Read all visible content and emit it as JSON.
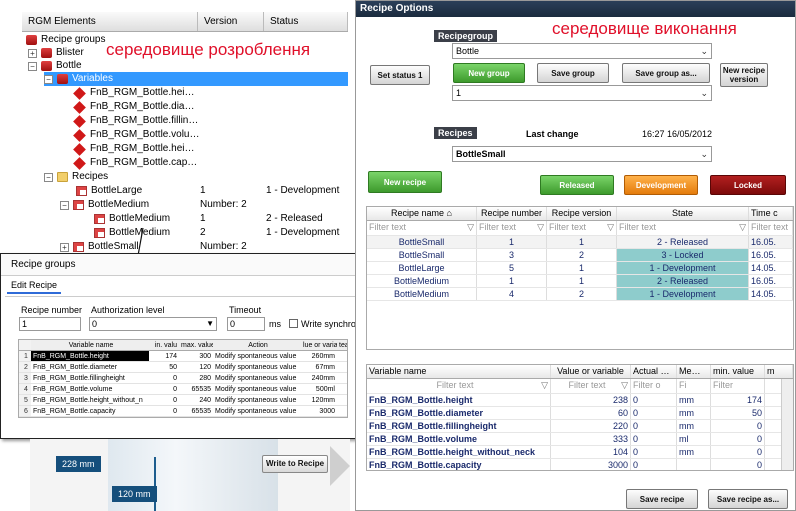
{
  "dev_tree": {
    "columns": [
      "RGM Elements",
      "Version",
      "Status"
    ],
    "overlay_text": "середовище розроблення",
    "nodes": [
      {
        "label": "Recipe groups",
        "version": "",
        "status": ""
      },
      {
        "label": "Blister",
        "version": "",
        "status": ""
      },
      {
        "label": "Bottle",
        "version": "",
        "status": ""
      },
      {
        "label": "Variables",
        "version": "",
        "status": ""
      },
      {
        "label": "FnB_RGM_Bottle.hei…",
        "version": "",
        "status": ""
      },
      {
        "label": "FnB_RGM_Bottle.dia…",
        "version": "",
        "status": ""
      },
      {
        "label": "FnB_RGM_Bottle.fillin…",
        "version": "",
        "status": ""
      },
      {
        "label": "FnB_RGM_Bottle.volu…",
        "version": "",
        "status": ""
      },
      {
        "label": "FnB_RGM_Bottle.hei…",
        "version": "",
        "status": ""
      },
      {
        "label": "FnB_RGM_Bottle.cap…",
        "version": "",
        "status": ""
      },
      {
        "label": "Recipes",
        "version": "",
        "status": ""
      },
      {
        "label": "BottleLarge",
        "version": "1",
        "status": "1 - Development"
      },
      {
        "label": "BottleMedium",
        "version": "Number: 2",
        "status": ""
      },
      {
        "label": "BottleMedium",
        "version": "1",
        "status": "2 - Released"
      },
      {
        "label": "BottleMedium",
        "version": "2",
        "status": "1 - Development"
      },
      {
        "label": "BottleSmall",
        "version": "Number: 2",
        "status": ""
      }
    ]
  },
  "popup": {
    "title": "Recipe groups",
    "tab": "Edit Recipe",
    "recipe_number_label": "Recipe number",
    "recipe_number_value": "1",
    "auth_label": "Authorization level",
    "auth_value": "0",
    "timeout_label": "Timeout",
    "timeout_value": "0",
    "timeout_unit": "ms",
    "write_sync_label": "Write synchronous",
    "table_headers": [
      "",
      "Variable name",
      "in. valu",
      "max. value",
      "Action",
      "lue or varia",
      "tea"
    ],
    "rows": [
      [
        "1",
        "FnB_RGM_Bottle.height",
        "174",
        "300",
        "Modify spontaneous value",
        "260mm",
        ""
      ],
      [
        "2",
        "FnB_RGM_Bottle.diameter",
        "50",
        "120",
        "Modify spontaneous value",
        "67mm",
        ""
      ],
      [
        "3",
        "FnB_RGM_Bottle.fillingheight",
        "0",
        "280",
        "Modify spontaneous value",
        "240mm",
        ""
      ],
      [
        "4",
        "FnB_RGM_Bottle.volume",
        "0",
        "65535",
        "Modify spontaneous value",
        "500ml",
        ""
      ],
      [
        "5",
        "FnB_RGM_Bottle.height_without_n",
        "0",
        "240",
        "Modify spontaneous value",
        "120mm",
        ""
      ],
      [
        "6",
        "FnB_RGM_Bottle.capacity",
        "0",
        "65535",
        "Modify spontaneous value",
        "3000",
        ""
      ]
    ]
  },
  "bottom_left": {
    "label_228": "228 mm",
    "label_120": "120 mm",
    "write_button": "Write to Recipe"
  },
  "runtime": {
    "title": "Recipe Options",
    "overlay_text": "середовище виконання",
    "recipegroup_label": "Recipegroup",
    "recipegroup_value": "Bottle",
    "second_select_value": "1",
    "buttons": {
      "set_status": "Set status 1",
      "new_group": "New group",
      "save_group": "Save group",
      "save_group_as": "Save group as...",
      "new_recipe_version": "New recipe version",
      "new_recipe": "New recipe",
      "released": "Released",
      "development": "Development",
      "locked": "Locked",
      "save_recipe": "Save recipe",
      "save_recipe_as": "Save recipe as..."
    },
    "recipes_label": "Recipes",
    "last_change_label": "Last change",
    "last_change_value": "16:27 16/05/2012",
    "recipe_select_value": "BottleSmall",
    "recipe_grid": {
      "headers": [
        "Recipe name",
        "Recipe number",
        "Recipe version",
        "State",
        "Time c"
      ],
      "filter_placeholder": "Filter text",
      "rows": [
        [
          "BottleSmall",
          "1",
          "1",
          "2 - Released",
          "16.05."
        ],
        [
          "BottleSmall",
          "3",
          "2",
          "3 - Locked",
          "16.05."
        ],
        [
          "BottleLarge",
          "5",
          "1",
          "1 - Development",
          "14.05."
        ],
        [
          "BottleMedium",
          "1",
          "1",
          "2 - Released",
          "16.05."
        ],
        [
          "BottleMedium",
          "4",
          "2",
          "1 - Development",
          "14.05."
        ]
      ]
    },
    "variable_grid": {
      "headers": [
        "Variable name",
        "Value or variable",
        "Actual …",
        "Me…",
        "min. value",
        "m"
      ],
      "filter_placeholder": "Filter text",
      "short_filters": [
        "Filter o",
        "Fi",
        "Filter"
      ],
      "rows": [
        [
          "FnB_RGM_Bottle.height",
          "238",
          "0",
          "mm",
          "174",
          ""
        ],
        [
          "FnB_RGM_Bottle.diameter",
          "60",
          "0",
          "mm",
          "50",
          ""
        ],
        [
          "FnB_RGM_Bottle.fillingheight",
          "220",
          "0",
          "mm",
          "0",
          ""
        ],
        [
          "FnB_RGM_Bottle.volume",
          "333",
          "0",
          "ml",
          "0",
          ""
        ],
        [
          "FnB_RGM_Bottle.height_without_neck",
          "104",
          "0",
          "mm",
          "0",
          ""
        ],
        [
          "FnB_RGM_Bottle.capacity",
          "3000",
          "0",
          "",
          "0",
          ""
        ]
      ]
    }
  }
}
